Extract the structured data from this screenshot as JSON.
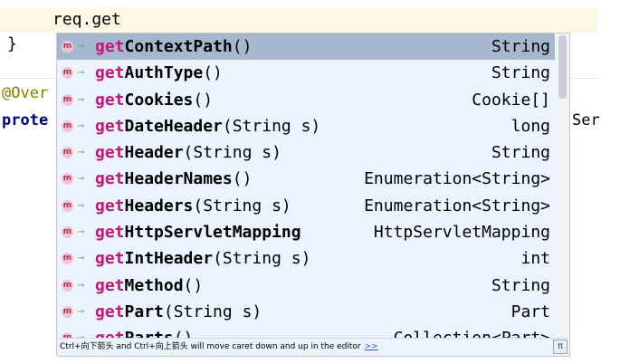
{
  "editor": {
    "current_line": "req.get",
    "brace": "}",
    "annotation_fragment": "@Over",
    "keyword_fragment": "prote",
    "right_fragment": "Ser"
  },
  "popup": {
    "selected_index": 0,
    "items": [
      {
        "prefix": "get",
        "rest": "ContextPath",
        "params": "()",
        "type": "String"
      },
      {
        "prefix": "get",
        "rest": "AuthType",
        "params": "()",
        "type": "String"
      },
      {
        "prefix": "get",
        "rest": "Cookies",
        "params": "()",
        "type": "Cookie[]"
      },
      {
        "prefix": "get",
        "rest": "DateHeader",
        "params": "(String s)",
        "type": "long"
      },
      {
        "prefix": "get",
        "rest": "Header",
        "params": "(String s)",
        "type": "String"
      },
      {
        "prefix": "get",
        "rest": "HeaderNames",
        "params": "()",
        "type": "Enumeration<String>"
      },
      {
        "prefix": "get",
        "rest": "Headers",
        "params": "(String s)",
        "type": "Enumeration<String>"
      },
      {
        "prefix": "get",
        "rest": "HttpServletMapping",
        "params": "",
        "type": "HttpServletMapping"
      },
      {
        "prefix": "get",
        "rest": "IntHeader",
        "params": "(String s)",
        "type": "int"
      },
      {
        "prefix": "get",
        "rest": "Method",
        "params": "()",
        "type": "String"
      },
      {
        "prefix": "get",
        "rest": "Part",
        "params": "(String s)",
        "type": "Part"
      },
      {
        "prefix": "get",
        "rest": "Parts",
        "params": "()",
        "type": "Collection<Part>"
      }
    ],
    "footer_text": "Ctrl+向下箭头 and Ctrl+向上箭头 will move caret down and up in the editor",
    "footer_link": ">>",
    "pi_label": "π"
  },
  "icons": {
    "method_icon_letter": "m",
    "public_icon_glyph": "⊸"
  }
}
